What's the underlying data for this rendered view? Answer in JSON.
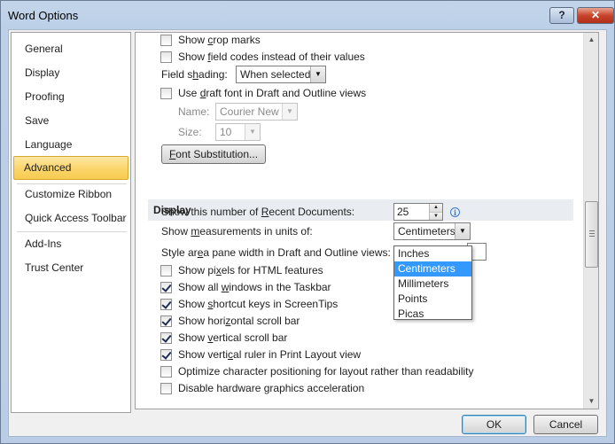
{
  "window": {
    "title": "Word Options",
    "help_glyph": "?",
    "close_glyph": "✕"
  },
  "sidebar": {
    "items": [
      {
        "label": "General"
      },
      {
        "label": "Display"
      },
      {
        "label": "Proofing"
      },
      {
        "label": "Save"
      },
      {
        "label": "Language"
      },
      {
        "label": "Advanced"
      },
      {
        "label": "Customize Ribbon"
      },
      {
        "label": "Quick Access Toolbar"
      },
      {
        "label": "Add-Ins"
      },
      {
        "label": "Trust Center"
      }
    ],
    "active": "Advanced"
  },
  "show_document_content": {
    "crop_marks": {
      "label_pre": "Show ",
      "accel": "c",
      "label_post": "rop marks",
      "checked": false
    },
    "field_codes": {
      "label_pre": "Show ",
      "accel": "f",
      "label_post": "ield codes instead of their values",
      "checked": false
    },
    "field_shading": {
      "label_pre": "Field s",
      "accel": "h",
      "label_post": "ading:",
      "value": "When selected"
    },
    "draft_font": {
      "label_pre": "Use ",
      "accel": "d",
      "label_post": "raft font in Draft and Outline views",
      "checked": false
    },
    "name": {
      "label": "Name:",
      "value": "Courier New"
    },
    "size": {
      "label": "Size:",
      "value": "10"
    },
    "font_substitution_button": {
      "accel": "F",
      "label_post": "ont Substitution..."
    }
  },
  "display_section": {
    "header": "Display",
    "recent_docs": {
      "label_pre": "Show this number of ",
      "accel": "R",
      "label_post": "ecent Documents:",
      "value": "25"
    },
    "measurement_units": {
      "label_pre": "Show ",
      "accel": "m",
      "label_post": "easurements in units of:",
      "value": "Centimeters"
    },
    "style_area": {
      "label_pre": "Style ar",
      "accel": "e",
      "label_post": "a pane width in Draft and Outline views:"
    },
    "units_options": [
      "Inches",
      "Centimeters",
      "Millimeters",
      "Points",
      "Picas"
    ],
    "units_selected": "Centimeters",
    "checkboxes": [
      {
        "pre": "Show pi",
        "accel": "x",
        "post": "els for HTML features",
        "checked": false
      },
      {
        "pre": "Show all ",
        "accel": "w",
        "post": "indows in the Taskbar",
        "checked": true
      },
      {
        "pre": "Show ",
        "accel": "s",
        "post": "hortcut keys in ScreenTips",
        "checked": true
      },
      {
        "pre": "Show hori",
        "accel": "z",
        "post": "ontal scroll bar",
        "checked": true
      },
      {
        "pre": "Show ",
        "accel": "v",
        "post": "ertical scroll bar",
        "checked": true
      },
      {
        "pre": "Show verti",
        "accel": "c",
        "post": "al ruler in Print Layout view",
        "checked": true
      },
      {
        "pre": "Optimize character positioning for layout rather than readability",
        "accel": "",
        "post": "",
        "checked": false
      },
      {
        "pre": "Disable hardware ",
        "accel": "g",
        "post": "raphics acceleration",
        "checked": false
      }
    ]
  },
  "footer": {
    "ok_label": "OK",
    "cancel_label": "Cancel"
  }
}
